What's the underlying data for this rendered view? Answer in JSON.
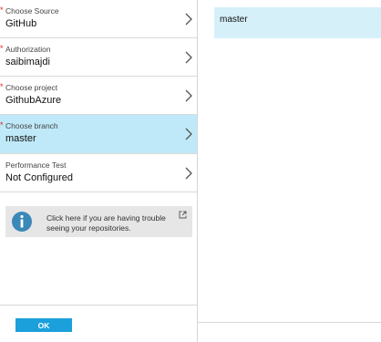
{
  "settings": [
    {
      "label": "Choose Source",
      "value": "GitHub",
      "required": "*"
    },
    {
      "label": "Authorization",
      "value": "saibimajdi",
      "required": "*"
    },
    {
      "label": "Choose project",
      "value": "GithubAzure",
      "required": "*"
    },
    {
      "label": "Choose branch",
      "value": "master",
      "required": "*"
    },
    {
      "label": "Performance Test",
      "value": "Not Configured",
      "required": ""
    }
  ],
  "info": {
    "text": "Click here if you are having trouble seeing your repositories.",
    "icon": "info-icon",
    "link_icon": "external-link-icon"
  },
  "ok_button": "OK",
  "branches": {
    "items": [
      "master"
    ],
    "selected": "master"
  },
  "colors": {
    "selected_row": "#bfe9f8",
    "branch_highlight": "#d6f0fa",
    "ok_button": "#1ca0dc",
    "required_marker": "#e0211d",
    "info_icon": "#3a89b8"
  }
}
